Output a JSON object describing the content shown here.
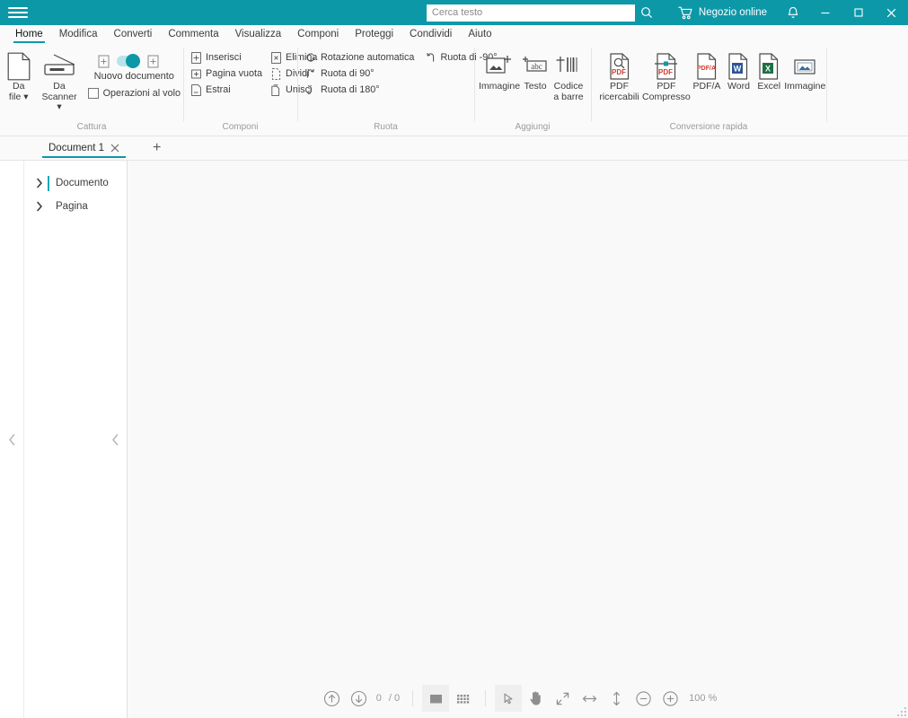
{
  "titlebar": {
    "menu_icon": "hamburger-icon",
    "search": {
      "placeholder": "Cerca testo",
      "value": ""
    },
    "search_icon": "search-icon",
    "shop_label": "Negozio online",
    "shop_icon": "cart-icon",
    "notifications_icon": "bell-icon",
    "minimize_label": "–",
    "maximize_label": "□",
    "close_label": "✕",
    "accent_color": "#0d98a8"
  },
  "menubar": {
    "items": [
      {
        "label": "Home",
        "active": true
      },
      {
        "label": "Modifica",
        "active": false
      },
      {
        "label": "Converti",
        "active": false
      },
      {
        "label": "Commenta",
        "active": false
      },
      {
        "label": "Visualizza",
        "active": false
      },
      {
        "label": "Componi",
        "active": false
      },
      {
        "label": "Proteggi",
        "active": false
      },
      {
        "label": "Condividi",
        "active": false
      },
      {
        "label": "Aiuto",
        "active": false
      }
    ]
  },
  "ribbon": {
    "groups": [
      {
        "caption": "Cattura",
        "big_buttons": [
          {
            "label_line1": "Da",
            "label_line2": "file ▾",
            "icon": "page-icon"
          },
          {
            "label_line1": "Da",
            "label_line2": "Scanner ▾",
            "icon": "scanner-icon"
          }
        ],
        "toggle_label": "Nuovo documento",
        "checkbox_label": "Operazioni al volo"
      },
      {
        "caption": "Componi",
        "col1": [
          {
            "label": "Inserisci",
            "icon": "insert-page-icon"
          },
          {
            "label": "Pagina vuota",
            "icon": "blank-page-icon"
          },
          {
            "label": "Estrai",
            "icon": "extract-page-icon"
          }
        ],
        "col2": [
          {
            "label": "Elimina",
            "icon": "delete-page-icon"
          },
          {
            "label": "Dividi",
            "icon": "split-icon"
          },
          {
            "label": "Unisci",
            "icon": "merge-icon"
          }
        ]
      },
      {
        "caption": "Ruota",
        "col1": [
          {
            "label": "Rotazione automatica",
            "icon": "auto-rotate-icon"
          },
          {
            "label": "Ruota di 90°",
            "icon": "rotate-cw-icon"
          },
          {
            "label": "Ruota di 180°",
            "icon": "rotate-180-icon"
          }
        ],
        "col2": [
          {
            "label": "Ruota di -90°",
            "icon": "rotate-ccw-icon"
          }
        ]
      },
      {
        "caption": "Aggiungi",
        "big_buttons": [
          {
            "label_line1": "Immagine",
            "label_line2": "",
            "icon": "add-image-icon"
          },
          {
            "label_line1": "Testo",
            "label_line2": "",
            "icon": "add-text-icon"
          },
          {
            "label_line1": "Codice",
            "label_line2": "a barre",
            "icon": "barcode-icon"
          }
        ]
      },
      {
        "caption": "Conversione rapida",
        "big_buttons": [
          {
            "label_line1": "PDF",
            "label_line2": "ricercabili",
            "icon": "searchable-pdf-icon"
          },
          {
            "label_line1": "PDF",
            "label_line2": "Compresso",
            "icon": "compressed-pdf-icon"
          },
          {
            "label_line1": "PDF/A",
            "label_line2": "",
            "icon": "pdfa-icon"
          },
          {
            "label_line1": "Word",
            "label_line2": "",
            "icon": "word-icon"
          },
          {
            "label_line1": "Excel",
            "label_line2": "",
            "icon": "excel-icon"
          },
          {
            "label_line1": "Immagine",
            "label_line2": "",
            "icon": "image-icon"
          }
        ]
      }
    ]
  },
  "tabstrip": {
    "tabs": [
      {
        "label": "Document 1",
        "close_icon": "close-icon",
        "active": true
      }
    ],
    "new_tab_label": "+"
  },
  "sidebar": {
    "collapse_icon_outer": "chevron-left-icon",
    "collapse_icon_inner": "chevron-left-icon",
    "items": [
      {
        "label": "Documento",
        "expander": "chevron-right-icon",
        "selected": true
      },
      {
        "label": "Pagina",
        "expander": "chevron-right-icon",
        "selected": false
      }
    ]
  },
  "bottombar": {
    "prev_page_icon": "arrow-up-circle-icon",
    "next_page_icon": "arrow-down-circle-icon",
    "current_page": "0",
    "page_separator": "/ 0",
    "view_single_icon": "single-page-icon",
    "view_grid_icon": "grid-view-icon",
    "tool_select_icon": "cursor-arrow-icon",
    "tool_hand_icon": "hand-icon",
    "fit_page_icon": "fit-page-icon",
    "fit_width_icon": "fit-width-icon",
    "fit_height_icon": "fit-height-icon",
    "zoom_out_icon": "zoom-out-icon",
    "zoom_in_icon": "zoom-in-icon",
    "zoom_level": "100 %"
  }
}
